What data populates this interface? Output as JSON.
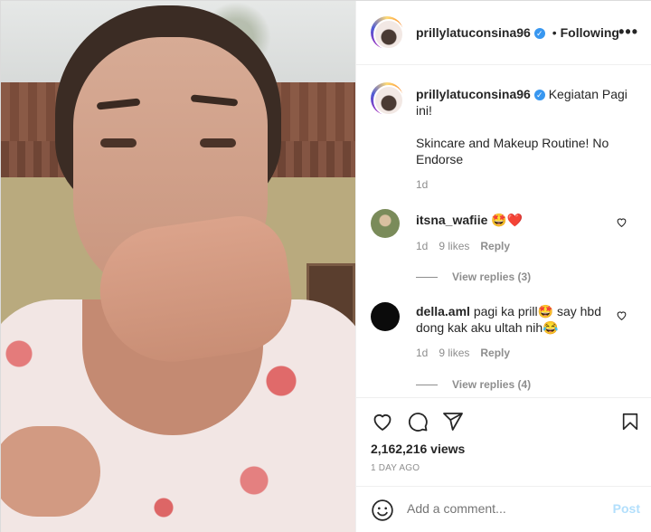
{
  "header": {
    "username": "prillylatuconsina96",
    "verified_glyph": "✓",
    "separator": "•",
    "follow_status": "Following",
    "more_icon": "more-horizontal-icon",
    "more_glyph": "•••"
  },
  "caption": {
    "username": "prillylatuconsina96",
    "line1": "Kegiatan Pagi",
    "line2": "ini!",
    "line3": "Skincare and Makeup Routine! No",
    "line4": "Endorse",
    "time": "1d"
  },
  "comments": [
    {
      "username": "itsna_wafiie",
      "text": "🤩❤️",
      "time": "1d",
      "likes": "9 likes",
      "reply_label": "Reply",
      "view_replies": "View replies (3)"
    },
    {
      "username": "della.aml",
      "text_line1": "pagi ka prill🤩 say hbd",
      "text_line2": "dong kak aku ultah nih😂",
      "time": "1d",
      "likes": "9 likes",
      "reply_label": "Reply",
      "view_replies": "View replies (4)"
    }
  ],
  "actions": {
    "icons": [
      "heart-icon",
      "comment-icon",
      "share-icon",
      "bookmark-icon"
    ],
    "views": "2,162,216 views",
    "time_ago": "1 DAY AGO"
  },
  "add_comment": {
    "placeholder": "Add a comment...",
    "post_label": "Post",
    "emoji_icon": "smiley-icon"
  },
  "colors": {
    "text": "#262626",
    "muted": "#8e8e8e",
    "verified": "#3897f0",
    "like": "#ed4956",
    "post_disabled": "#b2dffc",
    "border": "#dbdbdb"
  }
}
